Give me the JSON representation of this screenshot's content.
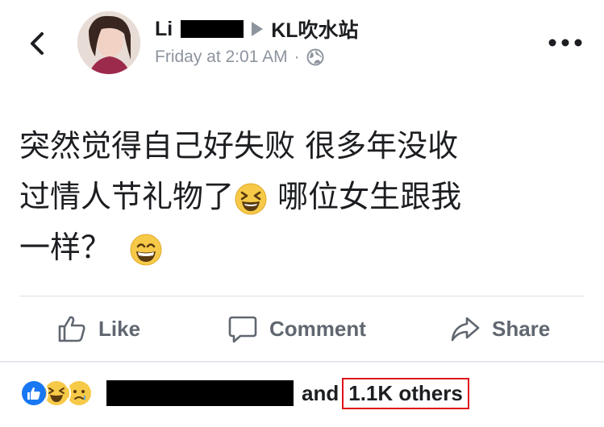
{
  "header": {
    "back_icon": "chevron-left-icon",
    "author_name": "Li",
    "group_arrow_icon": "triangle-right-icon",
    "group_name": "KL吹水站",
    "timestamp": "Friday at 2:01 AM",
    "separator": "·",
    "privacy_icon": "globe-icon",
    "more_icon": "more-dots-icon"
  },
  "post": {
    "line1": "突然觉得自己好失败 很多年没收",
    "line2": "过情人节礼物了",
    "line2_emoji": "laughing-squint-emoji",
    "line2_rest": " 哪位女生跟我",
    "line3": "一样？",
    "line3_emoji": "grinning-emoji"
  },
  "actions": {
    "like_label": "Like",
    "comment_label": "Comment",
    "share_label": "Share"
  },
  "reactions": {
    "icons": [
      "like-reaction-icon",
      "haha-reaction-icon",
      "sad-reaction-icon"
    ],
    "and_text": "and",
    "others_text": "1.1K others",
    "highlight_color": "#e0121a"
  },
  "colors": {
    "text_primary": "#1c1e21",
    "text_secondary": "#8d949e",
    "action_gray": "#606770",
    "like_blue": "#1877f2",
    "emoji_yellow": "#f7c948"
  }
}
